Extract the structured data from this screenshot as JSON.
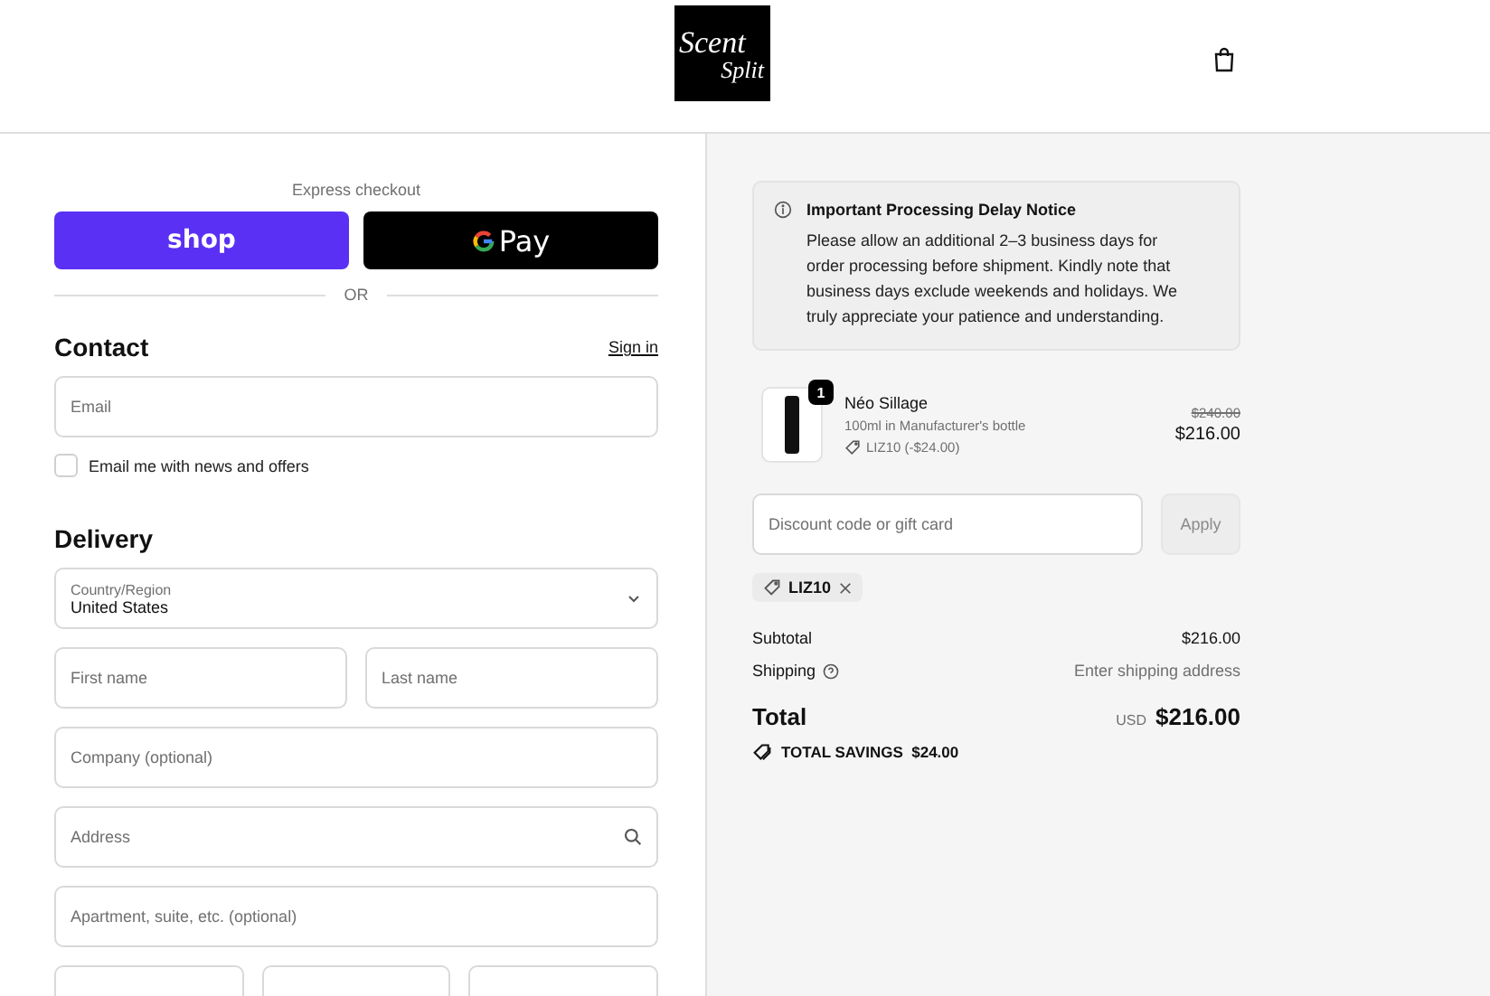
{
  "header": {
    "logo": [
      "Scent",
      "Split"
    ]
  },
  "express": {
    "title": "Express checkout",
    "buttons": [
      {
        "kind": "shop",
        "label": "shop"
      },
      {
        "kind": "gpay",
        "label": "Pay"
      }
    ],
    "divider": "OR"
  },
  "contact": {
    "heading": "Contact",
    "link": "Sign in",
    "email": {
      "placeholder": "Email"
    },
    "newsletter": {
      "label": "Email me with news and offers",
      "checked": false
    }
  },
  "delivery": {
    "heading": "Delivery",
    "country": {
      "label": "Country/Region",
      "value": "United States"
    },
    "rows": [
      [
        {
          "kind": "text",
          "placeholder": "First name"
        },
        {
          "kind": "text",
          "placeholder": "Last name"
        }
      ],
      [
        {
          "kind": "text",
          "placeholder": "Company (optional)"
        }
      ],
      [
        {
          "kind": "search",
          "placeholder": "Address"
        }
      ],
      [
        {
          "kind": "text",
          "placeholder": "Apartment, suite, etc. (optional)"
        }
      ],
      [
        {
          "kind": "text"
        },
        {
          "kind": "text"
        },
        {
          "kind": "text"
        }
      ]
    ]
  },
  "notice": {
    "title": "Important Processing Delay Notice",
    "body": "Please allow an additional 2–3 business days for order processing before shipment. Kindly note that business days exclude weekends and holidays. We truly appreciate your patience and understanding."
  },
  "line_items": [
    {
      "quantity": "1",
      "name": "Néo Sillage",
      "variant": "100ml in Manufacturer's bottle",
      "discount": "LIZ10 (-$24.00)",
      "compare_price": "$240.00",
      "price": "$216.00"
    }
  ],
  "discount": {
    "placeholder": "Discount code or gift card",
    "button": {
      "label": "Apply",
      "disabled": true
    },
    "codes": [
      "LIZ10"
    ]
  },
  "summary": {
    "rows": [
      {
        "kind": "plain",
        "label": "Subtotal",
        "value": "$216.00"
      },
      {
        "kind": "help",
        "label": "Shipping",
        "value": "Enter shipping address"
      }
    ],
    "total": {
      "label": "Total",
      "currency": "USD",
      "value": "$216.00"
    },
    "savings": {
      "label": "TOTAL SAVINGS",
      "value": "$24.00"
    }
  }
}
